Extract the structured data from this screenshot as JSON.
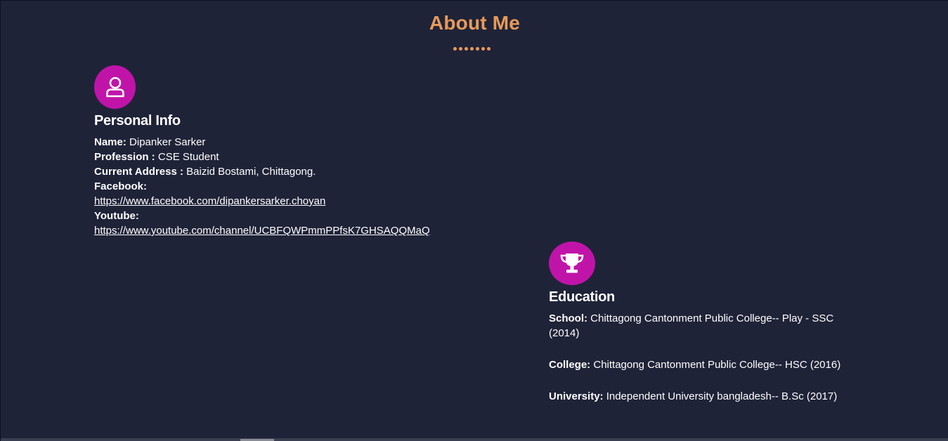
{
  "section": {
    "title": "About Me"
  },
  "colors": {
    "background": "#1f2338",
    "accent": "#e89a5a",
    "icon_bg": "#c014a9"
  },
  "personal": {
    "icon": "user-icon",
    "heading": "Personal Info",
    "name_label": "Name:",
    "name_value": "Dipanker Sarker",
    "profession_label": "Profession :",
    "profession_value": "CSE Student",
    "address_label": "Current Address :",
    "address_value": "Baizid Bostami, Chittagong.",
    "facebook_label": "Facebook:",
    "facebook_url": "https://www.facebook.com/dipankersarker.choyan",
    "youtube_label": "Youtube:",
    "youtube_url": "https://www.youtube.com/channel/UCBFQWPmmPPfsK7GHSAQQMaQ"
  },
  "education": {
    "icon": "trophy-icon",
    "heading": "Education",
    "school_label": "School:",
    "school_value": "Chittagong Cantonment Public College-- Play - SSC (2014)",
    "college_label": "College:",
    "college_value": "Chittagong Cantonment Public College-- HSC (2016)",
    "university_label": "University:",
    "university_value": "Independent University bangladesh-- B.Sc (2017)"
  }
}
